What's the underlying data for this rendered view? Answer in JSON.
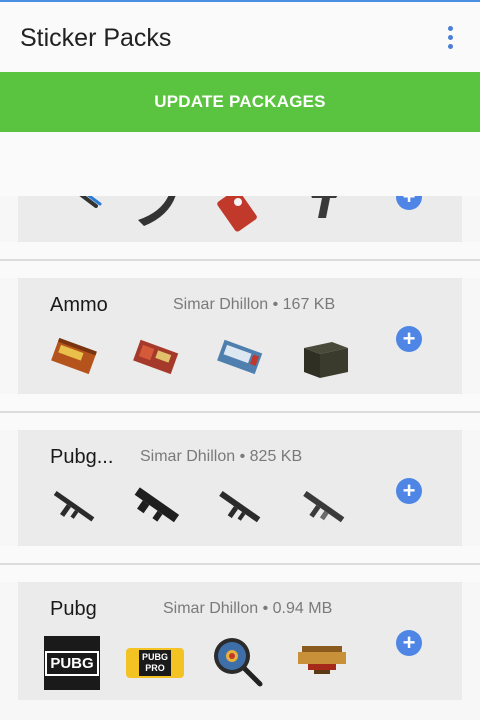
{
  "app": {
    "title": "Sticker Packs"
  },
  "toolbar": {
    "update_label": "UPDATE PACKAGES"
  },
  "packs": [
    {
      "name": "",
      "author": "",
      "size": "",
      "stickers": [
        "crossbow-bolts-icon",
        "banana-magazine-icon",
        "red-tag-icon",
        "rifle-stock-icon"
      ]
    },
    {
      "name": "Ammo",
      "author": "Simar Dhillon",
      "size": "167 KB",
      "stickers": [
        "ammo-box-orange-icon",
        "ammo-box-red-icon",
        "ammo-box-blue-icon",
        "ammo-crate-icon"
      ]
    },
    {
      "name": "Pubg...",
      "author": "Simar Dhillon",
      "size": "825 KB",
      "stickers": [
        "akm-rifle-icon",
        "groza-rifle-icon",
        "m416-rifle-icon",
        "scar-rifle-icon"
      ]
    },
    {
      "name": "Pubg",
      "author": "Simar Dhillon",
      "size": "0.94 MB",
      "stickers": [
        "pubg-logo-icon",
        "pubg-pro-logo-icon",
        "frying-pan-icon",
        "chicken-dinner-logo-icon"
      ]
    }
  ],
  "labels": {
    "pubg_logo": "PUBG",
    "pubg_pro_top": "PUBG",
    "pubg_pro_bottom": "PRO",
    "separator": "•"
  },
  "colors": {
    "accent_green": "#5ac33f",
    "add_blue": "#4f86e6"
  }
}
